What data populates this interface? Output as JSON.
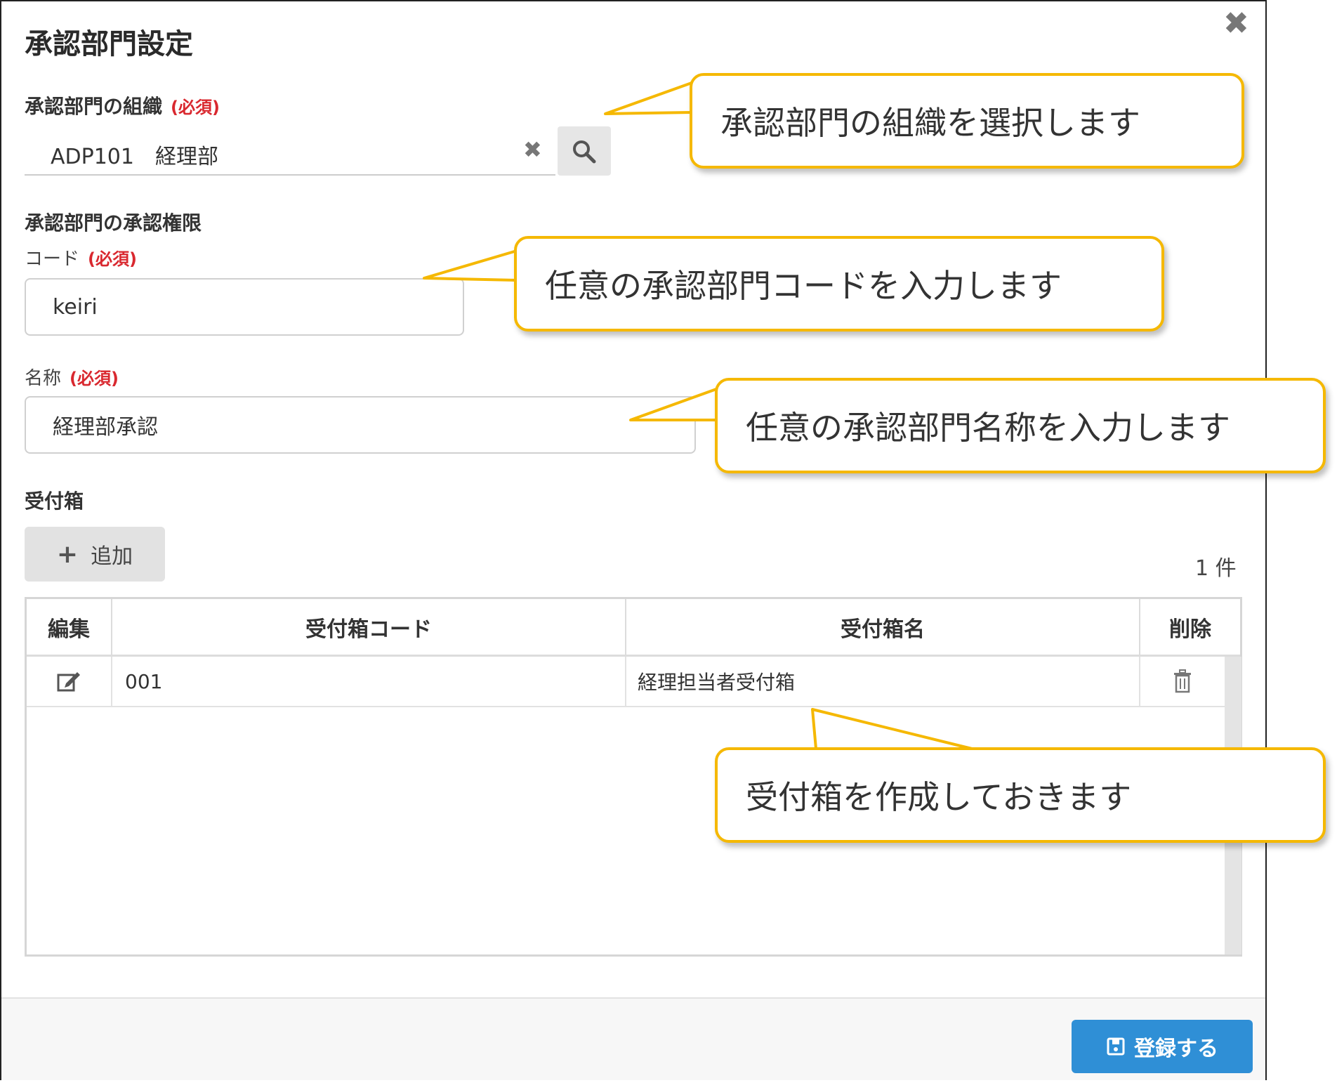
{
  "dialog": {
    "title": "承認部門設定",
    "close_symbol": "✖"
  },
  "org_section": {
    "label": "承認部門の組織",
    "required": "(必須)",
    "value": "ADP101　経理部",
    "clear_symbol": "✖"
  },
  "authority_section": {
    "label": "承認部門の承認権限",
    "code_label": "コード",
    "code_required": "(必須)",
    "code_value": "keiri",
    "name_label": "名称",
    "name_required": "(必須)",
    "name_value": "経理部承認"
  },
  "inbox_section": {
    "label": "受付箱",
    "add_plus": "+",
    "add_label": "追加",
    "count": "1 件",
    "table": {
      "headers": [
        "編集",
        "受付箱コード",
        "受付箱名",
        "削除"
      ],
      "rows": [
        {
          "code": "001",
          "name": "経理担当者受付箱"
        }
      ]
    }
  },
  "footer": {
    "save_label": "登録する"
  },
  "callouts": {
    "org": "承認部門の組織を選択します",
    "code": "任意の承認部門コードを入力します",
    "name": "任意の承認部門名称を入力します",
    "inbox": "受付箱を作成しておきます"
  },
  "colors": {
    "accent": "#2f8fd6",
    "required": "#d9282f",
    "callout_border": "#f5b800"
  },
  "icons": {
    "close": "close-icon",
    "clear": "clear-icon",
    "search": "search-icon",
    "plus": "plus-icon",
    "edit": "edit-icon",
    "delete": "trash-icon",
    "save": "save-icon"
  }
}
